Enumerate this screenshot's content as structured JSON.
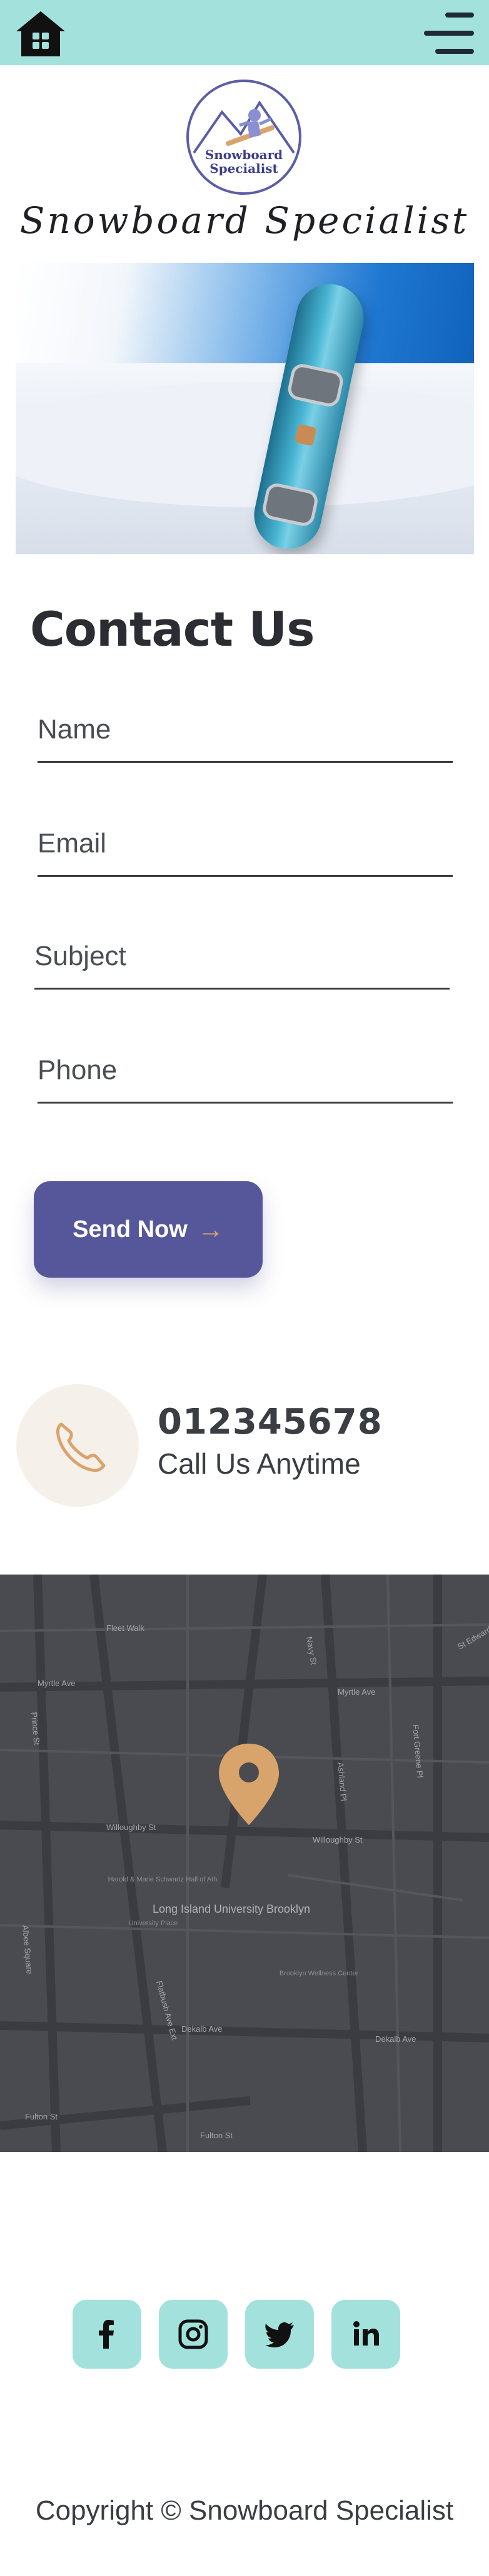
{
  "header": {
    "home_icon": "home-icon",
    "menu_icon": "menu-icon",
    "background": "#a3e2dc"
  },
  "brand": {
    "logo_text_line1": "Snowboard",
    "logo_text_line2": "Specialist",
    "site_title": "Snowboard Specialist"
  },
  "contact": {
    "title": "Contact Us",
    "fields": [
      {
        "label": "Name"
      },
      {
        "label": "Email"
      },
      {
        "label": "Subject"
      },
      {
        "label": "Phone"
      }
    ],
    "send_label": "Send Now",
    "send_color": "#56579b"
  },
  "call": {
    "number": "012345678",
    "subtitle": "Call Us Anytime",
    "icon": "phone-icon"
  },
  "map": {
    "streets": [
      "Fleet Walk",
      "Myrtle Ave",
      "Myrtle Ave",
      "Willoughby St",
      "Willoughby St",
      "Dekalb Ave",
      "Dekalb Ave",
      "Flatbush Ave Ext",
      "Ashland Pl",
      "Fulton St",
      "Fulton St",
      "Navy St",
      "Fort Greene Pl",
      "Prince St",
      "St Edwards St",
      "Albee Square"
    ],
    "places": [
      "Long Island University Brooklyn",
      "Harold & Marie Schwartz Hall of Ath",
      "University Place",
      "Brooklyn Wellness Center"
    ],
    "pin_color": "#d9a46c"
  },
  "social": [
    {
      "icon": "facebook-icon"
    },
    {
      "icon": "instagram-icon"
    },
    {
      "icon": "twitter-icon"
    },
    {
      "icon": "linkedin-icon"
    }
  ],
  "footer": {
    "copyright": "Copyright © Snowboard Specialist"
  }
}
